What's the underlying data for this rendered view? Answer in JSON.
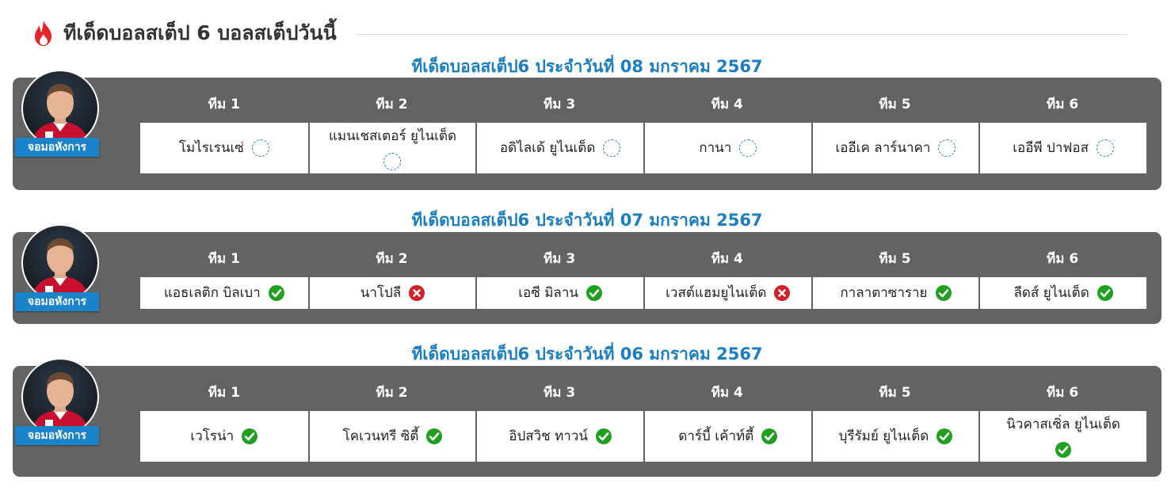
{
  "page": {
    "title": "ทีเด็ดบอลสเต็ป 6 บอลสเต็ปวันนี้",
    "title_icon": "fire-icon",
    "accent_color": "#1a7ec2",
    "panel_color": "#636363"
  },
  "blocks": [
    {
      "title": "ทีเด็ดบอลสเต็ป6 ประจำวันที่ 08 มกราคม 2567",
      "tipster": "จอมอหังการ",
      "teams": [
        {
          "header": "ทีม 1",
          "name": "โมไรเรนเซ่",
          "status": "pending"
        },
        {
          "header": "ทีม 2",
          "name": "แมนเชสเตอร์ ยูไนเต็ด",
          "status": "pending"
        },
        {
          "header": "ทีม 3",
          "name": "อดิไลเด้ ยูไนเต็ด",
          "status": "pending"
        },
        {
          "header": "ทีม 4",
          "name": "กานา",
          "status": "pending"
        },
        {
          "header": "ทีม 5",
          "name": "เออีเค ลาร์นาคา",
          "status": "pending"
        },
        {
          "header": "ทีม 6",
          "name": "เออีพี ปาฟอส",
          "status": "pending"
        }
      ]
    },
    {
      "title": "ทีเด็ดบอลสเต็ป6 ประจำวันที่ 07 มกราคม 2567",
      "tipster": "จอมอหังการ",
      "teams": [
        {
          "header": "ทีม 1",
          "name": "แอธเลติก บิลเบา",
          "status": "win"
        },
        {
          "header": "ทีม 2",
          "name": "นาโปลี",
          "status": "lose"
        },
        {
          "header": "ทีม 3",
          "name": "เอซี มิลาน",
          "status": "win"
        },
        {
          "header": "ทีม 4",
          "name": "เวสต์แฮมยูไนเต็ด",
          "status": "lose"
        },
        {
          "header": "ทีม 5",
          "name": "กาลาตาซาราย",
          "status": "win"
        },
        {
          "header": "ทีม 6",
          "name": "ลีดส์ ยูไนเต็ด",
          "status": "win"
        }
      ]
    },
    {
      "title": "ทีเด็ดบอลสเต็ป6 ประจำวันที่ 06 มกราคม 2567",
      "tipster": "จอมอหังการ",
      "teams": [
        {
          "header": "ทีม 1",
          "name": "เวโรน่า",
          "status": "win"
        },
        {
          "header": "ทีม 2",
          "name": "โคเวนทรี ซิตี้",
          "status": "win"
        },
        {
          "header": "ทีม 3",
          "name": "อิปสวิช ทาวน์",
          "status": "win"
        },
        {
          "header": "ทีม 4",
          "name": "ดาร์บี้ เค้าท์ตี้",
          "status": "win"
        },
        {
          "header": "ทีม 5",
          "name": "บุรีรัมย์ ยูไนเต็ด",
          "status": "win"
        },
        {
          "header": "ทีม 6",
          "name": "นิวคาสเซิ่ล ยูไนเต็ด",
          "status": "win"
        }
      ]
    }
  ],
  "status_colors": {
    "win": "#1fa01f",
    "lose": "#d0202a",
    "pending": "#1a83c9"
  }
}
